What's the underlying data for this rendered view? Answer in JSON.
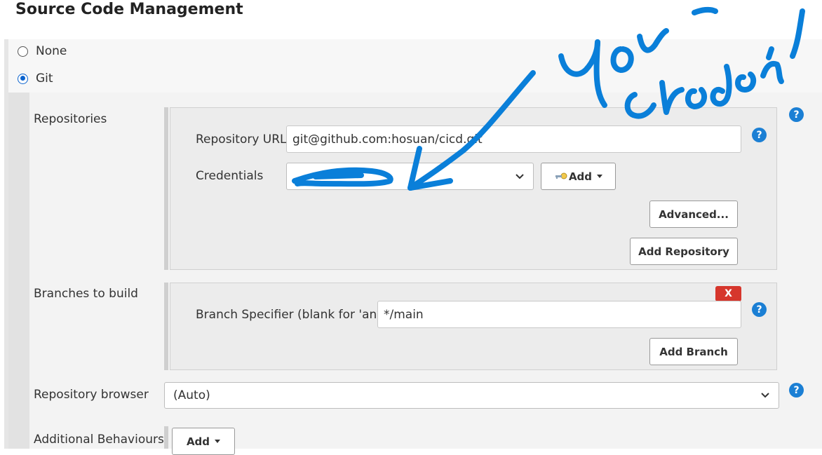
{
  "section": {
    "title": "Source Code Management"
  },
  "scm_options": [
    {
      "label": "None",
      "selected": false
    },
    {
      "label": "Git",
      "selected": true
    }
  ],
  "repositories": {
    "label": "Repositories",
    "url_label": "Repository URL",
    "url_value": "git@github.com:hosuan/cicd.git",
    "credentials_label": "Credentials",
    "credentials_value": "",
    "add_label": "Add",
    "advanced_label": "Advanced...",
    "add_repository_label": "Add Repository"
  },
  "branches": {
    "label": "Branches to build",
    "delete_label": "X",
    "specifier_label": "Branch Specifier (blank for 'any')",
    "specifier_value": "*/main",
    "add_branch_label": "Add Branch"
  },
  "repository_browser": {
    "label": "Repository browser",
    "value": "(Auto)"
  },
  "additional_behaviours": {
    "label": "Additional Behaviours",
    "add_label": "Add"
  },
  "help": {
    "glyph": "?"
  },
  "annotation": {
    "text": "your credentials",
    "color": "#0a7fd9"
  },
  "colors": {
    "help": "#1b7fd4",
    "delete": "#d6362c",
    "radio": "#0b63ce"
  }
}
